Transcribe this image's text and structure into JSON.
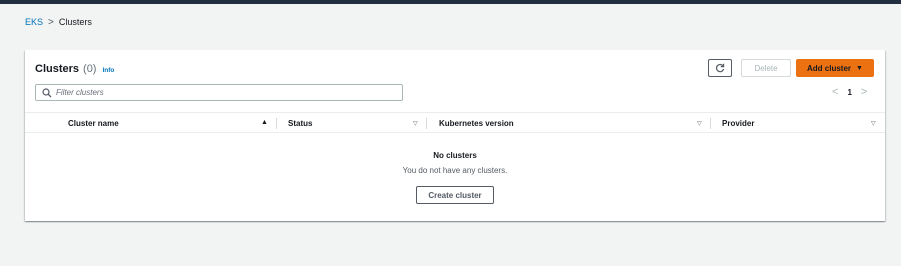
{
  "breadcrumb": {
    "root": "EKS",
    "separator": ">",
    "current": "Clusters"
  },
  "panel": {
    "title": "Clusters",
    "count": "(0)",
    "info": "Info"
  },
  "toolbar": {
    "refresh_icon": "refresh-icon",
    "delete_label": "Delete",
    "add_label": "Add cluster",
    "add_caret": "▼"
  },
  "filter": {
    "placeholder": "Filter clusters",
    "value": ""
  },
  "pagination": {
    "prev": "<",
    "page": "1",
    "next": ">"
  },
  "table": {
    "columns": [
      {
        "label": "Cluster name",
        "sort": "▲"
      },
      {
        "label": "Status",
        "sort": "▽"
      },
      {
        "label": "Kubernetes version",
        "sort": "▽"
      },
      {
        "label": "Provider",
        "sort": "▽"
      }
    ],
    "rows": []
  },
  "empty_state": {
    "title": "No clusters",
    "description": "You do not have any clusters.",
    "button": "Create cluster"
  },
  "colors": {
    "accent_orange": "#ec7211",
    "link_blue": "#0073bb",
    "topbar": "#232f3e"
  }
}
